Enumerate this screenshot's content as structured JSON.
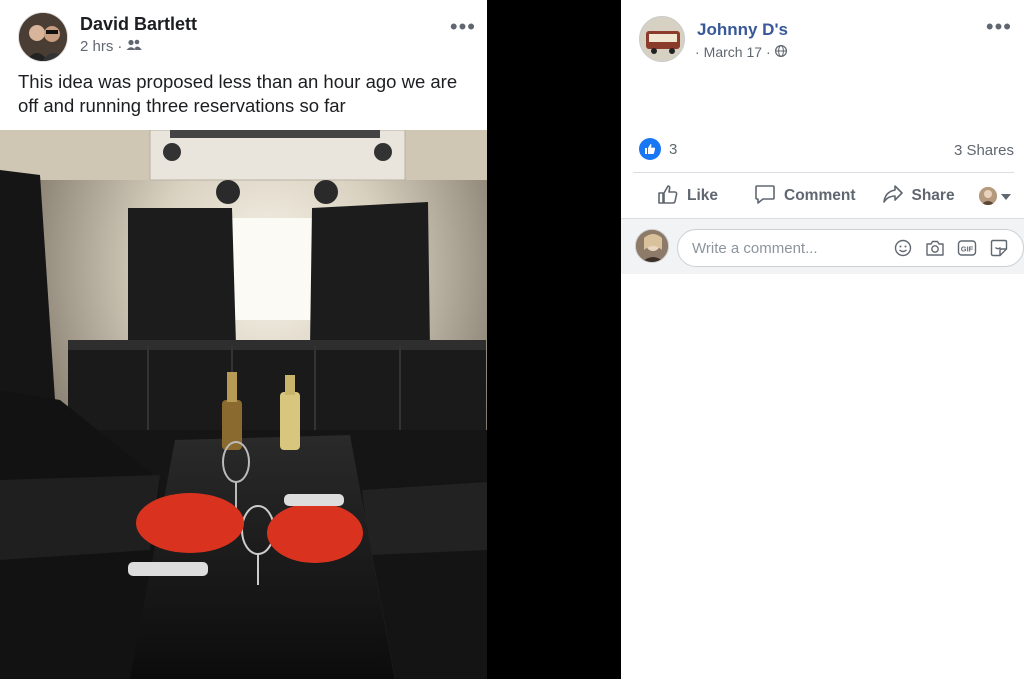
{
  "shared_post": {
    "author": "David Bartlett",
    "time": "2 hrs",
    "separator": "·",
    "audience_icon": "friends-icon",
    "text": "This idea was proposed less than an hour ago we are off and running three reservations so far",
    "more_icon": "more-horizontal-icon",
    "photo_icon": "party-bus-interior-photo"
  },
  "post": {
    "page_name": "Johnny D's",
    "date": "March 17",
    "separator": "·",
    "privacy_icon": "globe-icon",
    "more_icon": "more-horizontal-icon",
    "reaction_count": "3",
    "reaction_icon": "like-reaction-icon",
    "shares": "3 Shares"
  },
  "actions": {
    "like": "Like",
    "comment": "Comment",
    "share": "Share"
  },
  "comment": {
    "placeholder": "Write a comment...",
    "icons": [
      "emoji-icon",
      "camera-icon",
      "gif-icon",
      "sticker-icon"
    ]
  },
  "colors": {
    "link_blue": "#385898",
    "like_blue": "#1877f2",
    "muted_gray": "#606770"
  }
}
